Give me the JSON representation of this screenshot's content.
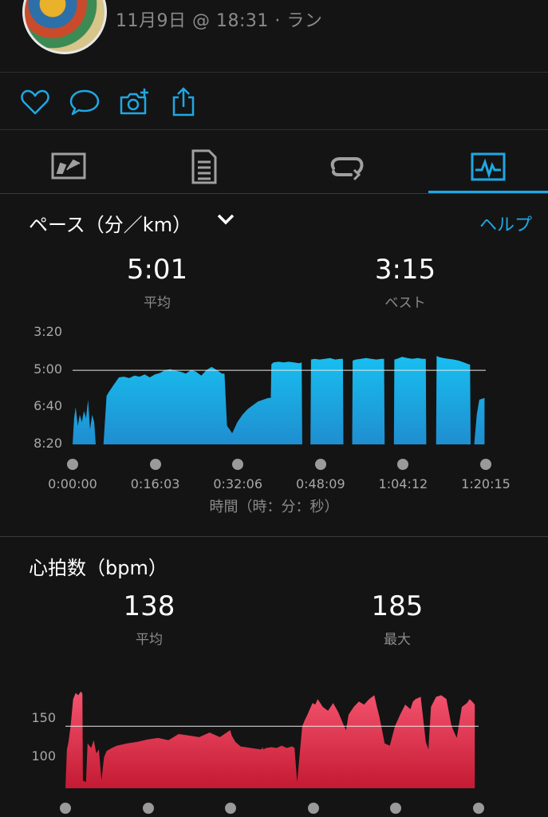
{
  "header": {
    "meta": "11月9日 @ 18:31 · ラン"
  },
  "actions": [
    {
      "name": "like",
      "icon": "heart-icon"
    },
    {
      "name": "comment",
      "icon": "comment-icon"
    },
    {
      "name": "add-photo",
      "icon": "camera-add-icon"
    },
    {
      "name": "share",
      "icon": "share-icon"
    }
  ],
  "tabs": [
    {
      "name": "overview",
      "icon": "map-stats-icon",
      "active": false
    },
    {
      "name": "details",
      "icon": "document-list-icon",
      "active": false
    },
    {
      "name": "laps",
      "icon": "laps-loop-icon",
      "active": false
    },
    {
      "name": "charts",
      "icon": "chart-pulse-icon",
      "active": true
    }
  ],
  "colors": {
    "accent": "#1ea8e4",
    "pace_top": "#18bff0",
    "pace_bottom": "#1f8ed0",
    "hr_top": "#f5546f",
    "hr_bottom": "#c41a33"
  },
  "pace": {
    "title": "ペース（分／km）",
    "help": "ヘルプ",
    "avg_value": "5:01",
    "avg_label": "平均",
    "best_value": "3:15",
    "best_label": "ベスト",
    "x_axis_label": "時間（時：分：秒）"
  },
  "heart_rate": {
    "title": "心拍数（bpm）",
    "avg_value": "138",
    "avg_label": "平均",
    "max_value": "185",
    "max_label": "最大"
  },
  "chart_data": [
    {
      "type": "area",
      "y_ticks": [
        "3:20",
        "5:00",
        "6:40",
        "8:20"
      ],
      "y_tick_values": [
        200,
        300,
        400,
        500
      ],
      "y_reversed": true,
      "ylim": [
        170,
        500
      ],
      "x_ticks": [
        "0:00:00",
        "0:16:03",
        "0:32:06",
        "0:48:09",
        "1:04:12",
        "1:20:15"
      ],
      "xlim": [
        0,
        80.25
      ],
      "reference_line": 301,
      "x": [
        0,
        0.3,
        0.6,
        1.0,
        1.4,
        1.8,
        2.2,
        2.6,
        3.0,
        3.4,
        3.8,
        4.2,
        4.5,
        6.0,
        6.6,
        7.0,
        8.0,
        9.0,
        10.0,
        11.0,
        12.0,
        13.0,
        14.0,
        15.0,
        16.0,
        17.0,
        18.0,
        19.0,
        20.0,
        21.0,
        22.0,
        23.0,
        24.0,
        25.0,
        26.0,
        27.0,
        28.0,
        29.0,
        29.5,
        30.0,
        30.5,
        31.0,
        32.0,
        33.0,
        34.0,
        35.0,
        36.0,
        37.0,
        38.0,
        38.5,
        38.6,
        39.0,
        40.0,
        41.0,
        42.0,
        43.0,
        44.0,
        44.5,
        44.6,
        46.2,
        46.3,
        47.0,
        48.0,
        49.0,
        50.0,
        51.0,
        52.0,
        52.5,
        52.6,
        54.3,
        54.4,
        55.0,
        56.0,
        57.0,
        58.0,
        59.0,
        60.0,
        60.5,
        60.6,
        62.4,
        62.5,
        63.0,
        64.0,
        65.0,
        66.0,
        67.0,
        68.0,
        68.6,
        68.7,
        70.6,
        70.7,
        71.0,
        72.0,
        73.0,
        74.0,
        75.0,
        76.0,
        77.0,
        77.2,
        77.3,
        78.0,
        78.5,
        79.0,
        80.0
      ],
      "y": [
        500,
        430,
        400,
        450,
        420,
        440,
        410,
        430,
        380,
        460,
        420,
        440,
        500,
        500,
        370,
        360,
        340,
        320,
        318,
        322,
        315,
        318,
        312,
        320,
        312,
        308,
        300,
        298,
        302,
        305,
        310,
        300,
        305,
        315,
        300,
        292,
        300,
        310,
        310,
        450,
        460,
        470,
        440,
        420,
        405,
        395,
        385,
        380,
        375,
        375,
        285,
        280,
        278,
        280,
        278,
        280,
        282,
        280,
        500,
        500,
        272,
        270,
        272,
        270,
        268,
        272,
        270,
        270,
        500,
        500,
        275,
        272,
        270,
        268,
        270,
        272,
        270,
        270,
        500,
        500,
        272,
        270,
        265,
        268,
        270,
        268,
        270,
        270,
        500,
        500,
        262,
        265,
        268,
        270,
        272,
        275,
        280,
        285,
        285,
        500,
        500,
        420,
        380,
        375
      ]
    },
    {
      "type": "area",
      "y_ticks": [
        "150",
        "100"
      ],
      "y_tick_values": [
        150,
        100
      ],
      "ylim": [
        60,
        200
      ],
      "xlim": [
        0,
        80.25
      ],
      "reference_line": 140,
      "x": [
        0,
        0.3,
        0.6,
        1.0,
        1.5,
        2.0,
        2.5,
        3.0,
        3.3,
        3.4,
        4.0,
        4.2,
        4.3,
        5.0,
        5.5,
        6.0,
        6.5,
        7.0,
        7.5,
        8.0,
        9.0,
        10.0,
        12.0,
        14.0,
        16.0,
        18.0,
        20.0,
        22.0,
        24.0,
        26.0,
        28.0,
        30.0,
        32.0,
        32.3,
        33.0,
        34.0,
        36.0,
        38.0,
        38.3,
        38.4,
        39.0,
        40.0,
        41.0,
        42.0,
        43.0,
        44.0,
        44.5,
        45.0,
        46.0,
        46.5,
        47.0,
        48.0,
        48.5,
        49.0,
        50.0,
        51.0,
        52.0,
        53.0,
        54.0,
        54.5,
        55.0,
        56.0,
        57.0,
        58.0,
        59.0,
        60.0,
        60.5,
        61.0,
        62.0,
        63.0,
        64.0,
        65.0,
        66.0,
        67.0,
        67.5,
        68.0,
        69.0,
        70.0,
        70.5,
        71.0,
        72.0,
        73.0,
        74.0,
        75.0,
        76.0,
        77.0,
        78.0,
        78.5,
        79.0,
        79.5
      ],
      "y": [
        60,
        110,
        120,
        140,
        175,
        183,
        180,
        185,
        182,
        70,
        68,
        100,
        118,
        112,
        122,
        105,
        110,
        70,
        100,
        108,
        112,
        115,
        118,
        120,
        123,
        125,
        122,
        130,
        128,
        126,
        132,
        126,
        135,
        128,
        120,
        114,
        112,
        110,
        113,
        110,
        112,
        113,
        112,
        115,
        112,
        114,
        112,
        68,
        140,
        148,
        155,
        170,
        168,
        175,
        165,
        160,
        170,
        158,
        142,
        135,
        155,
        165,
        172,
        168,
        175,
        180,
        165,
        152,
        118,
        115,
        140,
        155,
        168,
        162,
        172,
        175,
        178,
        120,
        110,
        165,
        178,
        180,
        175,
        140,
        125,
        165,
        170,
        175,
        172,
        168,
        175,
        172,
        170
      ]
    }
  ]
}
